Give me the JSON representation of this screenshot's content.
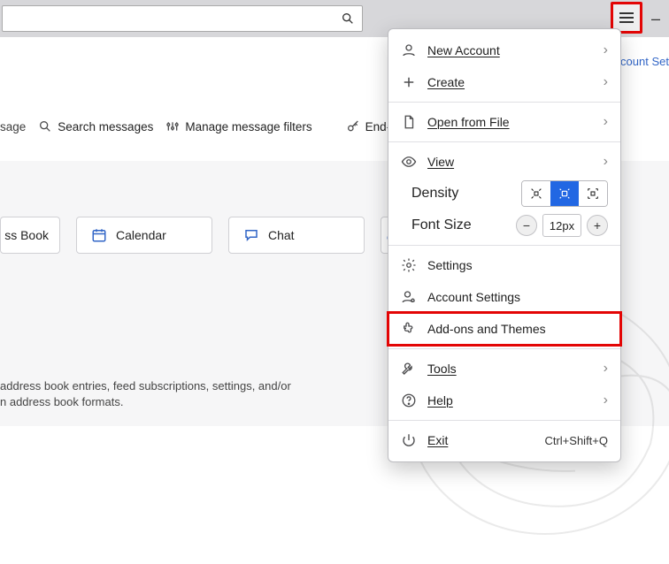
{
  "right_edge_button": "Account Set",
  "toolbar": {
    "sage": "sage",
    "search_messages": "Search messages",
    "manage_filters": "Manage message filters",
    "end_to": "End-to"
  },
  "cards": {
    "address_book": "ss Book",
    "calendar": "Calendar",
    "chat": "Chat"
  },
  "import_text_line1": "address book entries, feed subscriptions, settings, and/or",
  "import_text_line2": "n address book formats.",
  "footer_text": "",
  "menu": {
    "new_account": "New Account",
    "create": "Create",
    "open_from_file": "Open from File",
    "view": "View",
    "density": "Density",
    "font_size": "Font Size",
    "font_size_value": "12px",
    "settings": "Settings",
    "account_settings": "Account Settings",
    "addons": "Add-ons and Themes",
    "tools": "Tools",
    "help": "Help",
    "exit": "Exit",
    "exit_shortcut": "Ctrl+Shift+Q"
  }
}
